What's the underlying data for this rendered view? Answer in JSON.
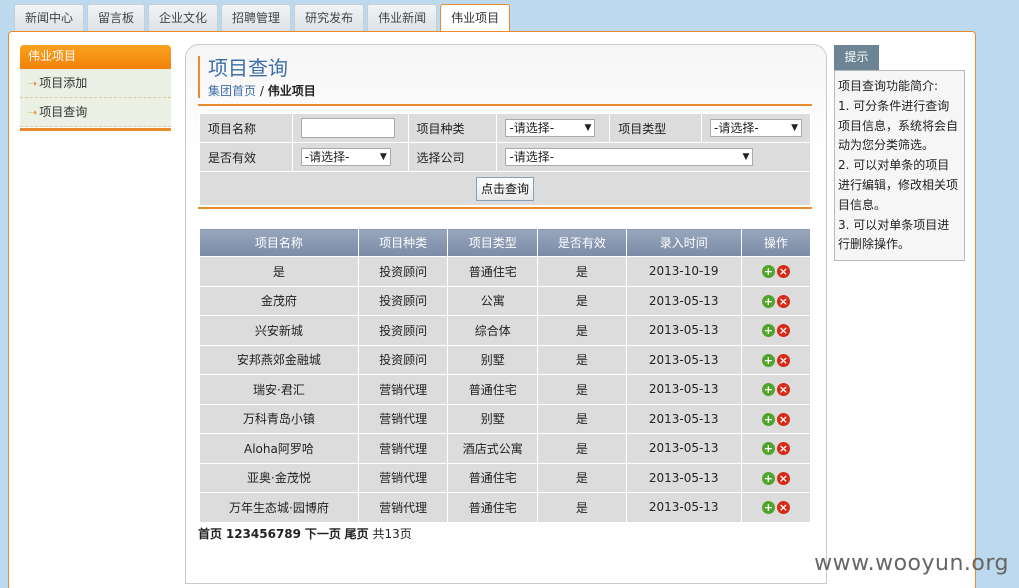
{
  "tabs": [
    "新闻中心",
    "留言板",
    "企业文化",
    "招聘管理",
    "研究发布",
    "伟业新闻",
    "伟业项目"
  ],
  "sidebar": {
    "title": "伟业项目",
    "items": [
      {
        "label": "项目添加"
      },
      {
        "label": "项目查询"
      }
    ]
  },
  "page": {
    "title": "项目查询",
    "crumb_home": "集团首页",
    "crumb_sep": "/",
    "crumb_current": "伟业项目"
  },
  "search": {
    "name_label": "项目名称",
    "name_value": "",
    "kind_label": "项目种类",
    "kind_value": "-请选择-",
    "type_label": "项目类型",
    "type_value": "-请选择-",
    "valid_label": "是否有效",
    "valid_value": "-请选择-",
    "company_label": "选择公司",
    "company_value": "-请选择-",
    "submit_label": "点击查询"
  },
  "table": {
    "headers": [
      "项目名称",
      "项目种类",
      "项目类型",
      "是否有效",
      "录入时间",
      "操作"
    ],
    "rows": [
      [
        "是",
        "投资顾问",
        "普通住宅",
        "是",
        "2013-10-19"
      ],
      [
        "金茂府",
        "投资顾问",
        "公寓",
        "是",
        "2013-05-13"
      ],
      [
        "兴安新城",
        "投资顾问",
        "综合体",
        "是",
        "2013-05-13"
      ],
      [
        "安邦燕郊金融城",
        "投资顾问",
        "别墅",
        "是",
        "2013-05-13"
      ],
      [
        "瑞安·君汇",
        "营销代理",
        "普通住宅",
        "是",
        "2013-05-13"
      ],
      [
        "万科青岛小镇",
        "营销代理",
        "别墅",
        "是",
        "2013-05-13"
      ],
      [
        "Aloha阿罗哈",
        "营销代理",
        "酒店式公寓",
        "是",
        "2013-05-13"
      ],
      [
        "亚奥·金茂悦",
        "营销代理",
        "普通住宅",
        "是",
        "2013-05-13"
      ],
      [
        "万年生态城·园博府",
        "营销代理",
        "普通住宅",
        "是",
        "2013-05-13"
      ]
    ]
  },
  "pager": {
    "first": "首页",
    "pages": "123456789",
    "next": "下一页",
    "last": "尾页",
    "total": "共13页"
  },
  "tip": {
    "tab_label": "提示",
    "text": "项目查询功能简介:\n1. 可分条件进行查询项目信息，系统将会自动为您分类筛选。\n2. 可以对单条的项目进行编辑，修改相关项目信息。\n3. 可以对单条项目进行删除操作。"
  },
  "watermark": "www.wooyun.org"
}
